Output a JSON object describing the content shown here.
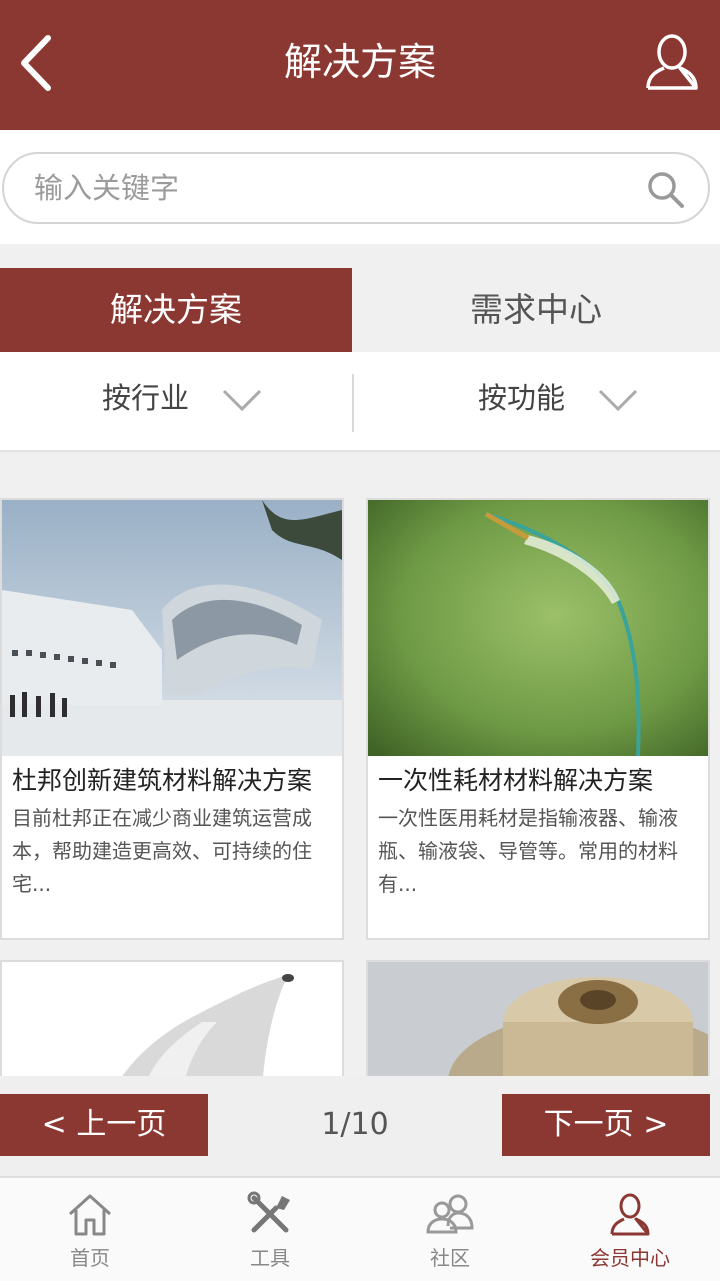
{
  "header": {
    "title": "解决方案",
    "back_icon": "back-arrow-icon",
    "user_icon": "user-icon"
  },
  "search": {
    "placeholder": "输入关键字",
    "value": "",
    "icon": "search-icon"
  },
  "tabs": [
    {
      "label": "解决方案",
      "active": true
    },
    {
      "label": "需求中心",
      "active": false
    }
  ],
  "filters": [
    {
      "label": "按行业",
      "icon": "chevron-down-icon"
    },
    {
      "label": "按功能",
      "icon": "chevron-down-icon"
    }
  ],
  "cards": [
    {
      "title": "杜邦创新建筑材料解决方案",
      "desc": "目前杜邦正在减少商业建筑运营成本，帮助建造更高效、可持续的住宅..."
    },
    {
      "title": "一次性耗材材料解决方案",
      "desc": "一次性医用耗材是指输液器、输液瓶、输液袋、导管等。常用的材料有..."
    }
  ],
  "pager": {
    "prev_label": "< 上一页",
    "next_label": "下一页 >",
    "page_text": "1/10"
  },
  "bottom_nav": [
    {
      "label": "首页",
      "icon": "home-icon",
      "active": false
    },
    {
      "label": "工具",
      "icon": "tools-icon",
      "active": false
    },
    {
      "label": "社区",
      "icon": "community-icon",
      "active": false
    },
    {
      "label": "会员中心",
      "icon": "member-icon",
      "active": true
    }
  ],
  "colors": {
    "brand": "#8b3833",
    "background": "#f0f0f0",
    "text_muted": "#9b9b9b"
  }
}
